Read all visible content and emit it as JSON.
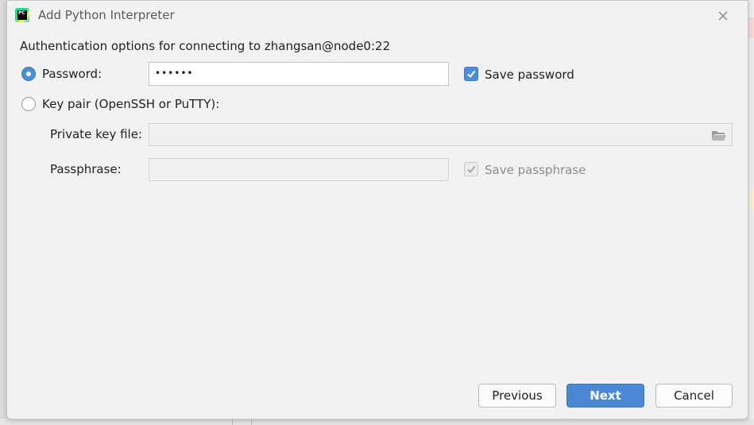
{
  "window": {
    "title": "Add Python Interpreter",
    "app_icon_text": "PC"
  },
  "auth": {
    "heading": "Authentication options for connecting to zhangsan@node0:22",
    "password_option_label": "Password:",
    "password_selected": true,
    "password_value": "••••••",
    "save_password_label": "Save password",
    "save_password_checked": true,
    "keypair_option_label": "Key pair (OpenSSH or PuTTY):",
    "keypair_selected": false,
    "private_key_label": "Private key file:",
    "private_key_value": "",
    "passphrase_label": "Passphrase:",
    "passphrase_value": "",
    "save_passphrase_label": "Save passphrase",
    "save_passphrase_checked": true
  },
  "footer": {
    "previous_label": "Previous",
    "next_label": "Next",
    "cancel_label": "Cancel"
  },
  "colors": {
    "accent": "#4a88d4",
    "dialog_bg": "#f2f2f2"
  },
  "icons": {
    "close": "close-icon",
    "folder": "folder-open-icon",
    "app": "pycharm-icon"
  }
}
